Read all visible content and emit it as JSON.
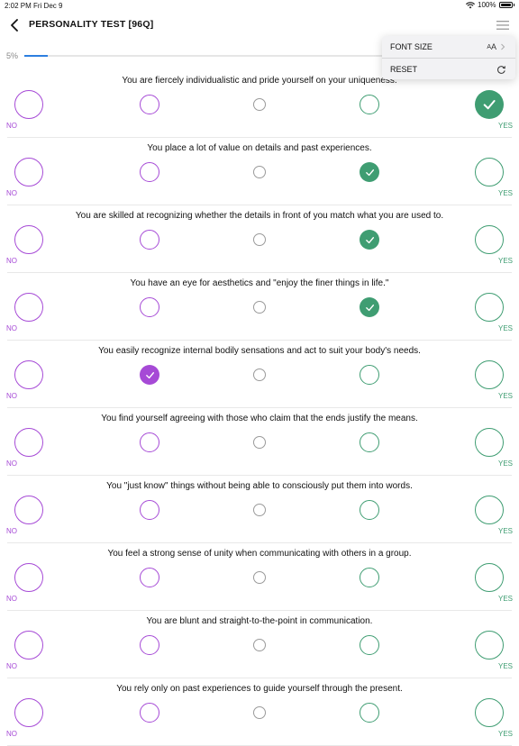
{
  "status_bar": {
    "time": "2:02 PM",
    "date": "Fri Dec 9",
    "battery": "100%"
  },
  "header": {
    "title": "PERSONALITY TEST [96Q]",
    "back_icon": "chevron-left-icon",
    "menu_icon": "hamburger-menu-icon"
  },
  "progress": {
    "label": "5%",
    "value": 0.05,
    "color": "#2d7fe0"
  },
  "menu": {
    "items": [
      {
        "label": "FONT SIZE",
        "icon_text": "AA",
        "icon": "font-size-icon"
      },
      {
        "label": "RESET",
        "icon": "refresh-icon"
      }
    ]
  },
  "scale": {
    "no_label": "NO",
    "yes_label": "YES"
  },
  "colors": {
    "disagree": "#a64ad6",
    "neutral": "#9a9a9a",
    "agree": "#3f9d72"
  },
  "questions": [
    {
      "text": "You are fiercely individualistic and pride yourself on your uniqueness.",
      "selected": 5
    },
    {
      "text": "You place a lot of value on details and past experiences.",
      "selected": 4
    },
    {
      "text": "You are skilled at recognizing whether the details in front of you match what you are used to.",
      "selected": 4
    },
    {
      "text": "You have an eye for aesthetics and \"enjoy the finer things in life.\"",
      "selected": 4
    },
    {
      "text": "You easily recognize internal bodily sensations and act to suit your body's needs.",
      "selected": 2
    },
    {
      "text": "You find yourself agreeing with those who claim that the ends justify the means.",
      "selected": 0
    },
    {
      "text": "You \"just know\" things without being able to consciously put them into words.",
      "selected": 0
    },
    {
      "text": "You feel a strong sense of unity when communicating with others in a group.",
      "selected": 0
    },
    {
      "text": "You are blunt and straight-to-the-point in communication.",
      "selected": 0
    },
    {
      "text": "You rely only on past experiences to guide yourself through the present.",
      "selected": 0
    }
  ]
}
